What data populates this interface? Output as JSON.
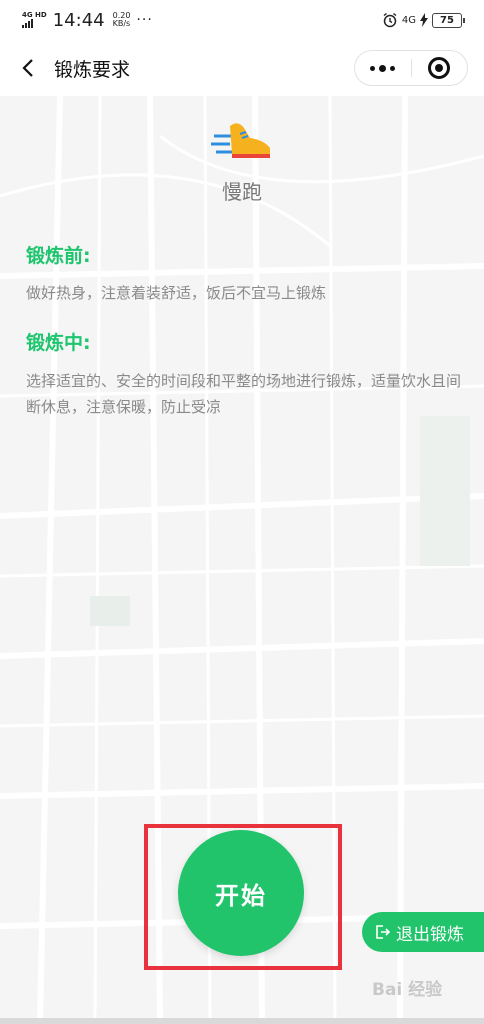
{
  "status_bar": {
    "network_tag": "4G HD",
    "time": "14:44",
    "speed_value": "0.20",
    "speed_unit": "KB/s",
    "more_dots": "···",
    "network_right": "4G",
    "battery": "75"
  },
  "nav": {
    "title": "锻炼要求"
  },
  "activity": {
    "name": "慢跑",
    "icon": "running-shoe-icon"
  },
  "sections": [
    {
      "title": "锻炼前:",
      "text": "做好热身，注意着装舒适，饭后不宜马上锻炼"
    },
    {
      "title": "锻炼中:",
      "text": "选择适宜的、安全的时间段和平整的场地进行锻炼，适量饮水且间断休息，注意保暖，防止受凉"
    }
  ],
  "buttons": {
    "start_label": "开始",
    "exit_label": "退出锻炼"
  },
  "watermark": {
    "text": "Bai 经验"
  },
  "colors": {
    "accent_green": "#22c46b",
    "section_title_green": "#1ec56e",
    "highlight_red": "#e8323c"
  }
}
